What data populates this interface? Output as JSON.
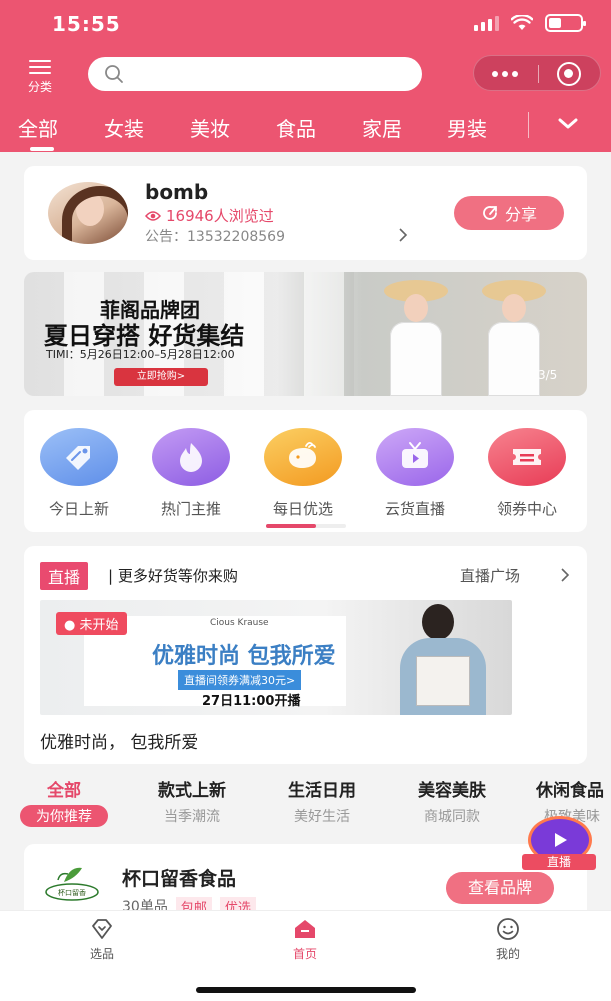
{
  "status_bar": {
    "time": "15:55"
  },
  "header": {
    "category_label": "分类",
    "tabs": [
      "全部",
      "女装",
      "美妆",
      "食品",
      "家居",
      "男装"
    ],
    "active_tab": "全部"
  },
  "store": {
    "name": "bomb",
    "views": "16946人浏览过",
    "notice": "公告：13532208569",
    "share_label": "分享"
  },
  "banner": {
    "brand": "菲阁品牌团",
    "title": "夏日穿搭 好货集结",
    "time": "TIMI：5月26日12:00–5月28日12:00",
    "button": "立即抢购>",
    "page_indicator": "3/5"
  },
  "quick_icons": [
    {
      "label": "今日上新",
      "icon": "tag-icon",
      "color": "#7aa6f0"
    },
    {
      "label": "热门主推",
      "icon": "flame-icon",
      "color": "#a779e9"
    },
    {
      "label": "每日优选",
      "icon": "whale-icon",
      "color": "#f6b23c"
    },
    {
      "label": "云货直播",
      "icon": "tv-icon",
      "color": "#b584f0"
    },
    {
      "label": "领券中心",
      "icon": "ticket-icon",
      "color": "#f05a6e"
    }
  ],
  "live": {
    "badge": "直播",
    "subtitle": "| 更多好货等你来购",
    "more": "直播广场",
    "status": "未开始",
    "brand": "Cious Krause",
    "slogan": "优雅时尚 包我所爱",
    "coupon": "直播间领券满减30元>",
    "start_time": "27日11:00开播",
    "title": "优雅时尚， 包我所爱"
  },
  "category_strip": [
    {
      "title": "全部",
      "sub": "为你推荐"
    },
    {
      "title": "款式上新",
      "sub": "当季潮流"
    },
    {
      "title": "生活日用",
      "sub": "美好生活"
    },
    {
      "title": "美容美肤",
      "sub": "商城同款"
    },
    {
      "title": "休闲食品",
      "sub": "极致美味"
    }
  ],
  "floating_live": {
    "label": "直播"
  },
  "brand_card": {
    "name": "杯口留香食品",
    "count": "30单品",
    "tags": [
      "包邮",
      "优选"
    ],
    "button": "查看品牌",
    "logo_text": "杯口留香"
  },
  "bottom_nav": [
    {
      "label": "选品",
      "icon": "diamond-icon"
    },
    {
      "label": "首页",
      "icon": "home-icon"
    },
    {
      "label": "我的",
      "icon": "smile-icon"
    }
  ],
  "colors": {
    "primary": "#ec5571",
    "accent_text": "#e5486a",
    "button": "#f07082"
  }
}
